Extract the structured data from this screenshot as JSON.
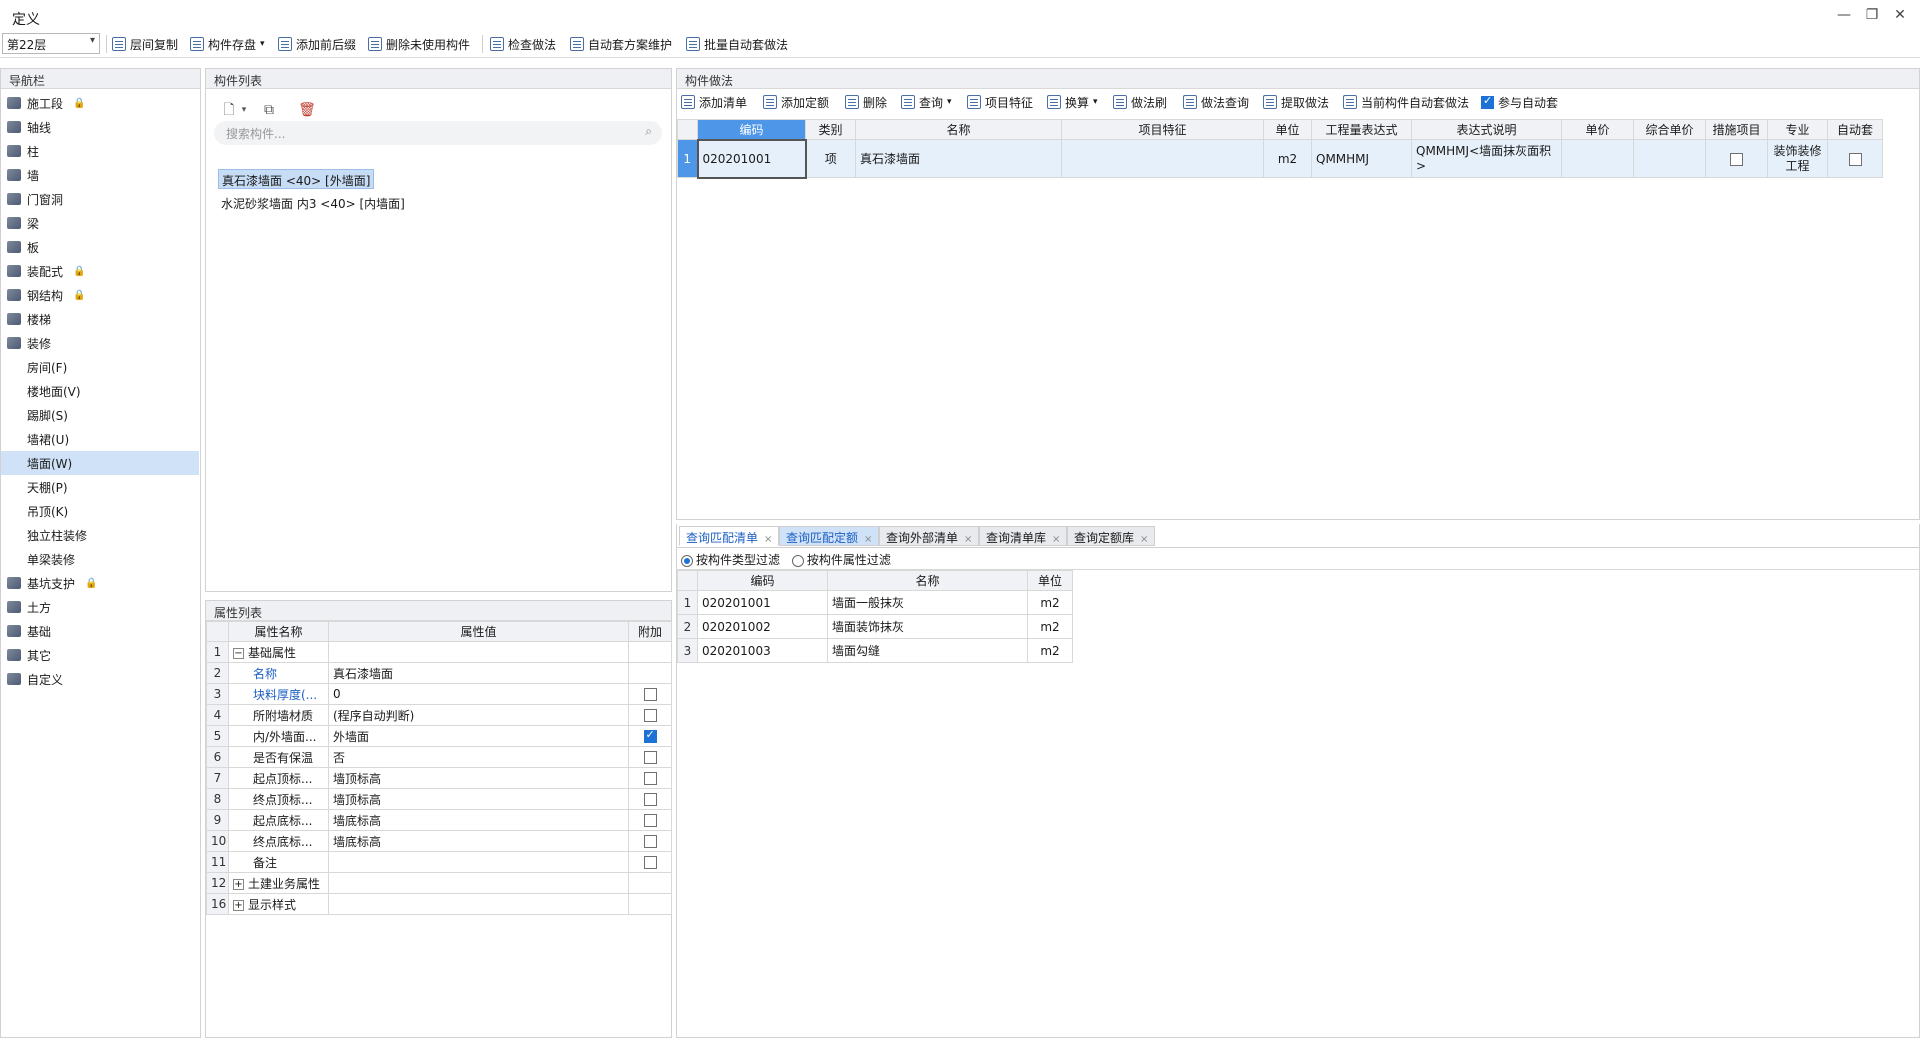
{
  "window": {
    "title": "定义",
    "minimize": "—",
    "restore": "❐",
    "close": "✕"
  },
  "toolbar": {
    "floor": "第22层",
    "items": [
      "层间复制",
      "构件存盘",
      "添加前后缀",
      "删除未使用构件",
      "检查做法",
      "自动套方案维护",
      "批量自动套做法"
    ]
  },
  "nav": {
    "title": "导航栏",
    "items": [
      {
        "label": "施工段",
        "lock": true
      },
      {
        "label": "轴线"
      },
      {
        "label": "柱"
      },
      {
        "label": "墙"
      },
      {
        "label": "门窗洞"
      },
      {
        "label": "梁"
      },
      {
        "label": "板"
      },
      {
        "label": "装配式",
        "lock": true
      },
      {
        "label": "钢结构",
        "lock": true
      },
      {
        "label": "楼梯"
      },
      {
        "label": "装修"
      },
      {
        "label": "房间(F)",
        "sub": true
      },
      {
        "label": "楼地面(V)",
        "sub": true
      },
      {
        "label": "踢脚(S)",
        "sub": true
      },
      {
        "label": "墙裙(U)",
        "sub": true
      },
      {
        "label": "墙面(W)",
        "sub": true,
        "selected": true
      },
      {
        "label": "天棚(P)",
        "sub": true
      },
      {
        "label": "吊顶(K)",
        "sub": true
      },
      {
        "label": "独立柱装修",
        "sub": true
      },
      {
        "label": "单梁装修",
        "sub": true
      },
      {
        "label": "基坑支护",
        "lock": true
      },
      {
        "label": "土方"
      },
      {
        "label": "基础"
      },
      {
        "label": "其它"
      },
      {
        "label": "自定义"
      }
    ]
  },
  "components": {
    "title": "构件列表",
    "search_placeholder": "搜索构件...",
    "items": [
      "真石漆墙面 <40> [外墙面]",
      "水泥砂浆墙面 内3 <40> [内墙面]"
    ]
  },
  "properties": {
    "title": "属性列表",
    "headers": [
      "属性名称",
      "属性值",
      "附加"
    ],
    "rows": [
      {
        "no": "1",
        "name": "基础属性",
        "value": "",
        "group": true,
        "expand": "−"
      },
      {
        "no": "2",
        "name": "名称",
        "value": "真石漆墙面",
        "blue": true
      },
      {
        "no": "3",
        "name": "块料厚度(...",
        "value": "0",
        "blue": true,
        "check": "off"
      },
      {
        "no": "4",
        "name": "所附墙材质",
        "value": "(程序自动判断)",
        "check": "off"
      },
      {
        "no": "5",
        "name": "内/外墙面...",
        "value": "外墙面",
        "check": "on"
      },
      {
        "no": "6",
        "name": "是否有保温",
        "value": "否",
        "check": "off"
      },
      {
        "no": "7",
        "name": "起点顶标...",
        "value": "墙顶标高",
        "check": "off"
      },
      {
        "no": "8",
        "name": "终点顶标...",
        "value": "墙顶标高",
        "check": "off"
      },
      {
        "no": "9",
        "name": "起点底标...",
        "value": "墙底标高",
        "check": "off"
      },
      {
        "no": "10",
        "name": "终点底标...",
        "value": "墙底标高",
        "check": "off"
      },
      {
        "no": "11",
        "name": "备注",
        "value": "",
        "check": "off"
      },
      {
        "no": "12",
        "name": "土建业务属性",
        "value": "",
        "group": true,
        "expand": "+"
      },
      {
        "no": "16",
        "name": "显示样式",
        "value": "",
        "group": true,
        "expand": "+"
      }
    ]
  },
  "method": {
    "title": "构件做法",
    "toolbar": [
      "添加清单",
      "添加定额",
      "删除",
      "查询",
      "项目特征",
      "换算",
      "做法刷",
      "做法查询",
      "提取做法",
      "当前构件自动套做法"
    ],
    "auto_check_label": "参与自动套",
    "headers": [
      "编码",
      "类别",
      "名称",
      "项目特征",
      "单位",
      "工程量表达式",
      "表达式说明",
      "单价",
      "综合单价",
      "措施项目",
      "专业",
      "自动套"
    ],
    "rows": [
      {
        "no": "1",
        "code": "020201001",
        "type": "项",
        "name": "真石漆墙面",
        "feature": "",
        "unit": "m2",
        "expr": "QMMHMJ",
        "expr_desc": "QMMHMJ<墙面抹灰面积>",
        "price": "",
        "total": "",
        "major": "装饰装修工程"
      }
    ]
  },
  "query": {
    "tabs": [
      {
        "label": "查询匹配清单",
        "state": "active"
      },
      {
        "label": "查询匹配定额",
        "state": "hl"
      },
      {
        "label": "查询外部清单",
        "state": ""
      },
      {
        "label": "查询清单库",
        "state": ""
      },
      {
        "label": "查询定额库",
        "state": ""
      }
    ],
    "filter1": "按构件类型过滤",
    "filter2": "按构件属性过滤",
    "headers": [
      "编码",
      "名称",
      "单位"
    ],
    "rows": [
      {
        "no": "1",
        "code": "020201001",
        "name": "墙面一般抹灰",
        "unit": "m2"
      },
      {
        "no": "2",
        "code": "020201002",
        "name": "墙面装饰抹灰",
        "unit": "m2"
      },
      {
        "no": "3",
        "code": "020201003",
        "name": "墙面勾缝",
        "unit": "m2"
      }
    ]
  }
}
